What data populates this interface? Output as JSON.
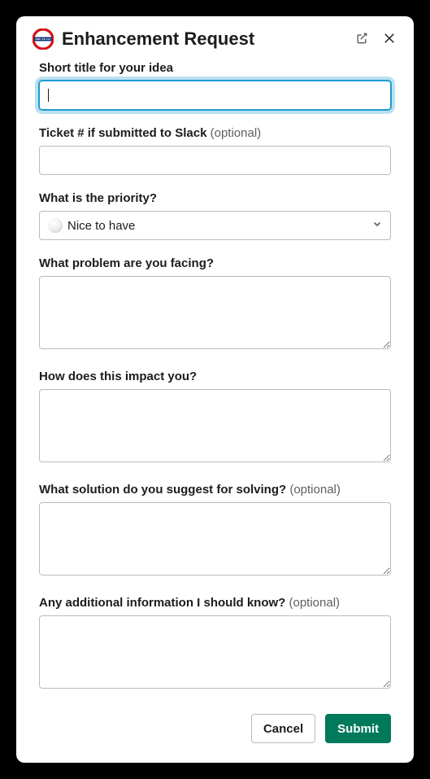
{
  "header": {
    "title": "Enhancement Request"
  },
  "fields": {
    "title": {
      "label": "Short title for your idea",
      "value": ""
    },
    "ticket": {
      "label": "Ticket # if submitted to Slack ",
      "optional": "(optional)",
      "value": ""
    },
    "priority": {
      "label": "What is the priority?",
      "selected": "Nice to have"
    },
    "problem": {
      "label": "What problem are you facing?",
      "value": ""
    },
    "impact": {
      "label": "How does this impact you?",
      "value": ""
    },
    "solution": {
      "label": "What solution do you suggest for solving? ",
      "optional": "(optional)",
      "value": ""
    },
    "additional": {
      "label": "Any additional information I should know? ",
      "optional": "(optional)",
      "value": ""
    }
  },
  "footer": {
    "cancel": "Cancel",
    "submit": "Submit"
  }
}
